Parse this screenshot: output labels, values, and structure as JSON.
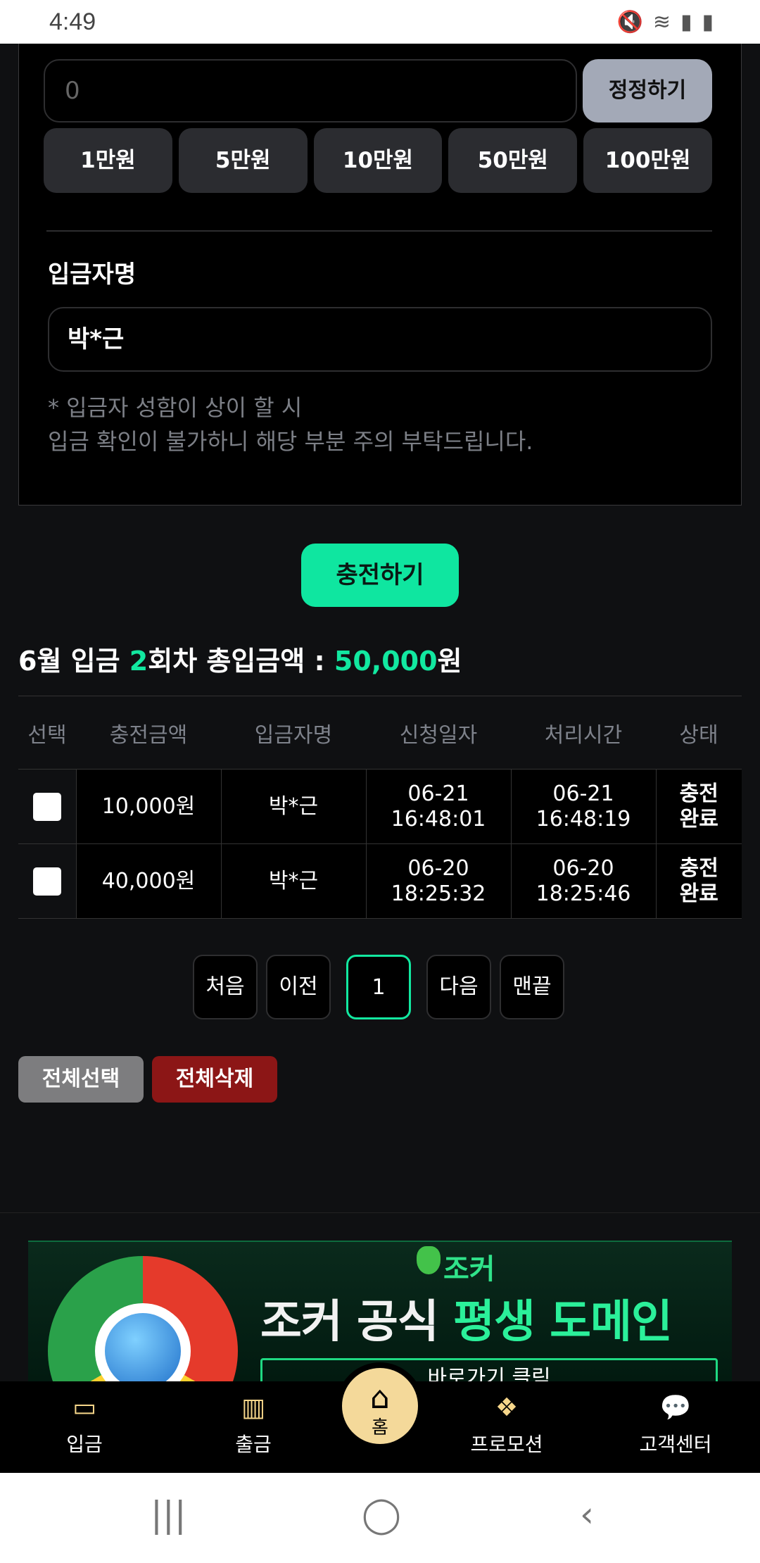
{
  "status_bar": {
    "time": "4:49",
    "icons": [
      "mute-icon",
      "wifi-icon",
      "signal-icon",
      "battery-icon"
    ]
  },
  "amount": {
    "value": "0",
    "correct_label": "정정하기"
  },
  "quick_amounts": [
    "1만원",
    "5만원",
    "10만원",
    "50만원",
    "100만원"
  ],
  "depositor": {
    "label": "입금자명",
    "value": "박*근",
    "notice_line1": "* 입금자 성함이 상이 할 시",
    "notice_line2": "입금 확인이 불가하니 해당 부분 주의 부탁드립니다."
  },
  "charge_label": "충전하기",
  "summary": {
    "month": "6월 입금 ",
    "count": "2",
    "mid": "회차 총입금액 : ",
    "total": "50,000",
    "unit": "원"
  },
  "table": {
    "headers": [
      "선택",
      "충전금액",
      "입금자명",
      "신청일자",
      "처리시간",
      "상태"
    ],
    "rows": [
      {
        "amount": "10,000원",
        "name": "박*근",
        "req_date": "06-21",
        "req_time": "16:48:01",
        "proc_date": "06-21",
        "proc_time": "16:48:19",
        "status1": "충전",
        "status2": "완료"
      },
      {
        "amount": "40,000원",
        "name": "박*근",
        "req_date": "06-20",
        "req_time": "18:25:32",
        "proc_date": "06-20",
        "proc_time": "18:25:46",
        "status1": "충전",
        "status2": "완료"
      }
    ]
  },
  "pager": {
    "first": "처음",
    "prev": "이전",
    "current": "1",
    "next": "다음",
    "last": "맨끝"
  },
  "actions": {
    "select_all": "전체선택",
    "delete_all": "전체삭제"
  },
  "banner": {
    "logo": "조커",
    "title_white": "조커 공식 ",
    "title_green": "평생 도메인",
    "sub": "바로가기 클릭"
  },
  "bottom_nav": {
    "deposit": "입금",
    "withdraw": "출금",
    "home": "홈",
    "promotion": "프로모션",
    "support": "고객센터"
  },
  "colors": {
    "accent": "#12e8a0",
    "danger": "#8c1616",
    "home_gold": "#f4d99a"
  }
}
